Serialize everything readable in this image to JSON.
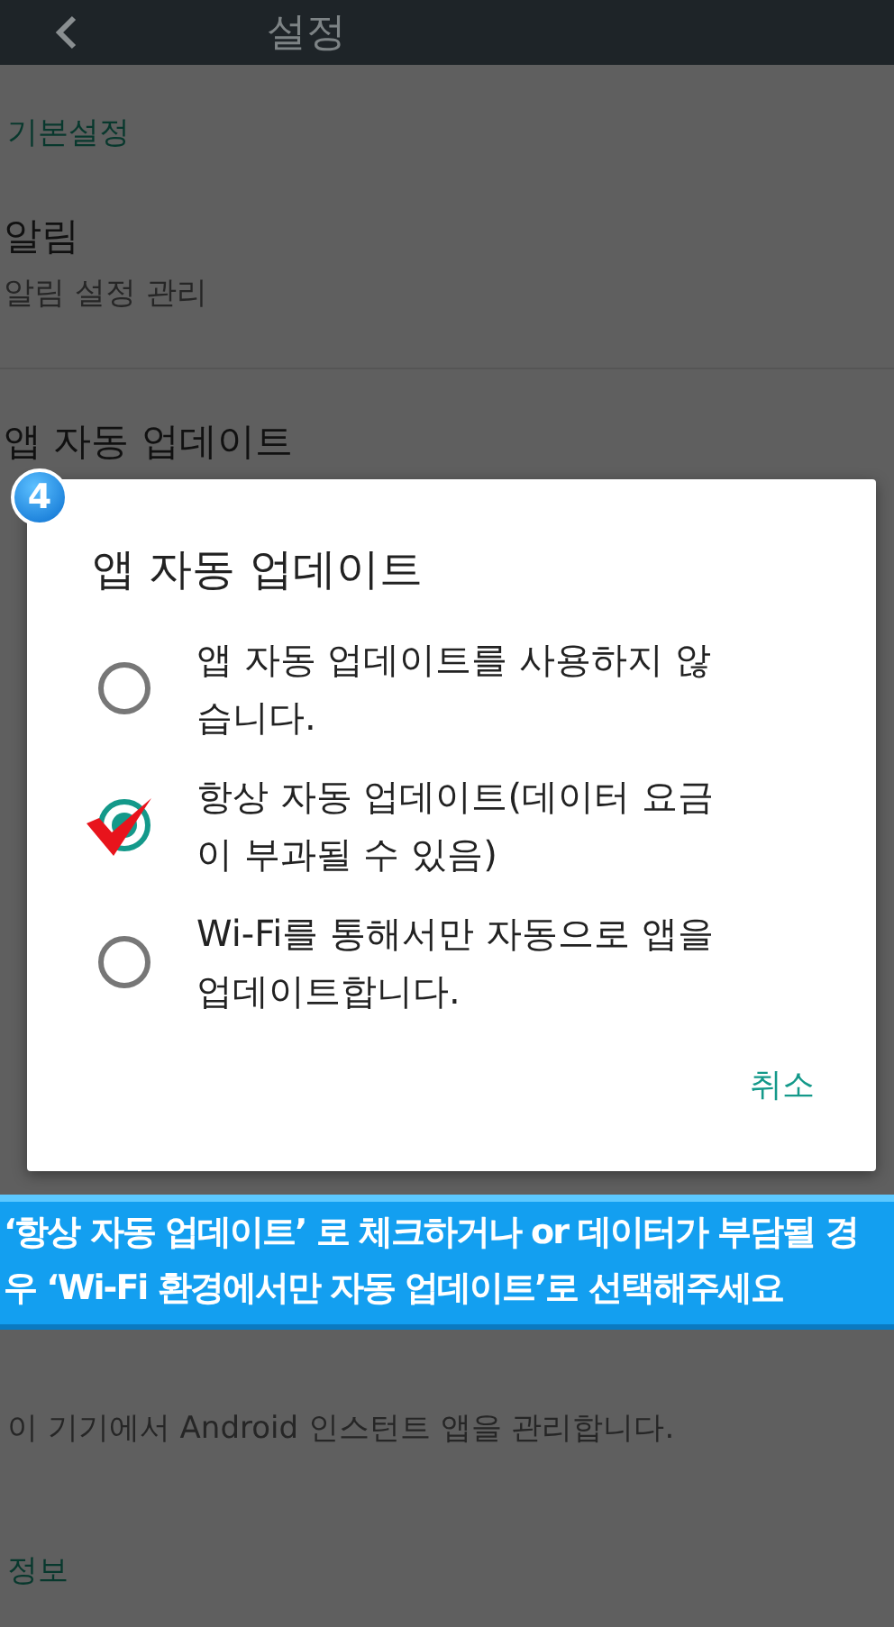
{
  "app_bar": {
    "title": "설정"
  },
  "settings": {
    "section": "기본설정",
    "items": [
      {
        "title": "알림",
        "summary": "알림 설정 관리"
      },
      {
        "title": "앱 자동 업데이트"
      }
    ],
    "lower_summary": "이 기기에서 Android 인스턴트 앱을 관리합니다.",
    "lower_section": "정보"
  },
  "step_badge": "4",
  "dialog": {
    "title": "앱 자동 업데이트",
    "options": [
      {
        "label": "앱 자동 업데이트를 사용하지 않습니다.",
        "selected": false
      },
      {
        "label": "항상 자동 업데이트(데이터 요금이 부과될 수 있음)",
        "selected": true
      },
      {
        "label": "Wi-Fi를 통해서만 자동으로 앱을 업데이트합니다.",
        "selected": false
      }
    ],
    "button": "취소"
  },
  "callout": "‘항상 자동 업데이트’ 로 체크하거나 or 데이터가 부담될 경우 ‘Wi-Fi 환경에서만 자동 업데이트’로 선택해주세요"
}
